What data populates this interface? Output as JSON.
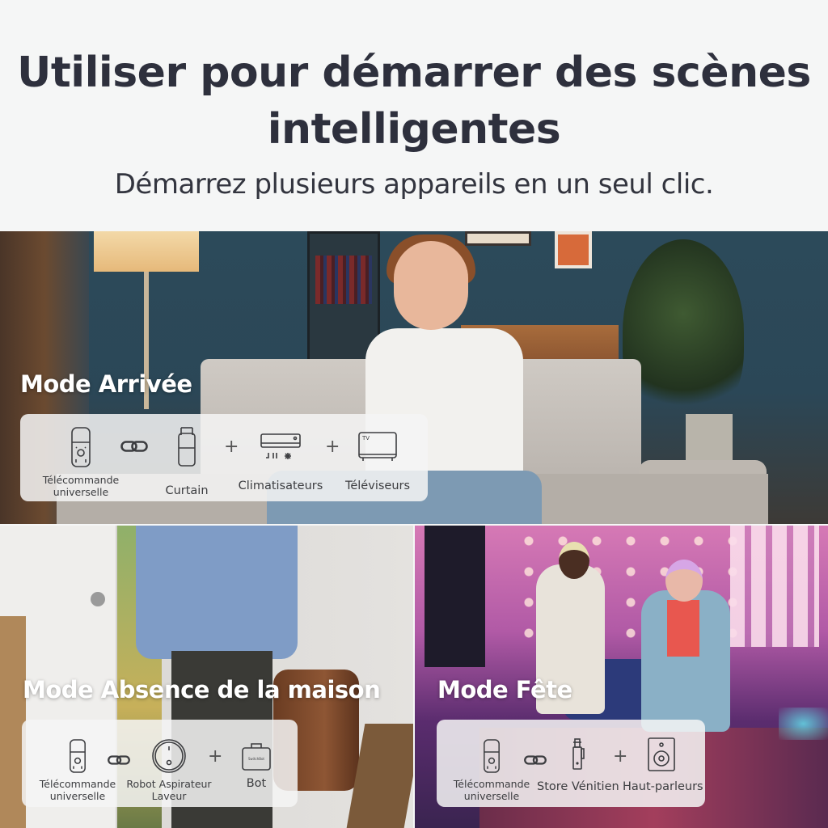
{
  "header": {
    "title_line1": "Utiliser pour démarrer des scènes",
    "title_line2": "intelligentes",
    "subtitle": "Démarrez plusieurs appareils en un seul clic."
  },
  "scenes": [
    {
      "title": "Mode Arrivée",
      "items": [
        {
          "icon": "universal-remote-icon",
          "label_line1": "Télécommande",
          "label_line2": "universelle"
        },
        {
          "separator": "link-icon"
        },
        {
          "icon": "curtain-icon",
          "label_line1": "Curtain"
        },
        {
          "separator": "+"
        },
        {
          "icon": "air-conditioner-icon",
          "label_line1": "Climatisateurs"
        },
        {
          "separator": "+"
        },
        {
          "icon": "tv-icon",
          "label_line1": "Téléviseurs",
          "icon_text": "TV"
        }
      ]
    },
    {
      "title": "Mode Absence de la maison",
      "items": [
        {
          "icon": "universal-remote-icon",
          "label_line1": "Télécommande",
          "label_line2": "universelle"
        },
        {
          "separator": "link-icon"
        },
        {
          "icon": "robot-vacuum-icon",
          "label_line1": "Robot Aspirateur",
          "label_line2": "Laveur"
        },
        {
          "separator": "+"
        },
        {
          "icon": "bot-icon",
          "label_line1": "Bot",
          "icon_text": "SwitchBot"
        }
      ]
    },
    {
      "title": "Mode Fête",
      "items": [
        {
          "icon": "universal-remote-icon",
          "label_line1": "Télécommande",
          "label_line2": "universelle"
        },
        {
          "separator": "link-icon"
        },
        {
          "icon": "blind-tilt-icon",
          "label_line1": "Store Vénitien"
        },
        {
          "separator": "+"
        },
        {
          "icon": "speaker-icon",
          "label_line1": "Haut-parleurs"
        }
      ]
    }
  ],
  "colors": {
    "heading_text": "#2e303d",
    "background": "#f5f6f6",
    "card_background": "#f5f5f5",
    "icon_stroke": "#3c3d40"
  }
}
